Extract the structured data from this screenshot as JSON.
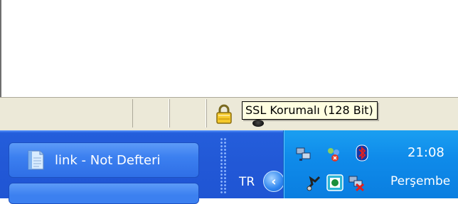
{
  "statusbar": {
    "ssl_tooltip": "SSL Korumalı (128 Bit)",
    "icons": [
      "lock-icon",
      "internet-zone-icon"
    ]
  },
  "taskbar": {
    "task_button_label": "link - Not Defteri",
    "task_button_icon": "notepad-icon"
  },
  "tray": {
    "language": "TR",
    "time": "21:08",
    "day": "Perşembe",
    "icons": [
      "network-connections-icon",
      "users-icon",
      "bluetooth-icon",
      "antivirus-icon",
      "software-update-icon",
      "network-disconnected-icon"
    ]
  },
  "colors": {
    "taskbar_blue": "#245edb",
    "tray_blue": "#0f8bea",
    "tooltip_bg": "#ffffe1",
    "statusbar_bg": "#ece9d8"
  }
}
